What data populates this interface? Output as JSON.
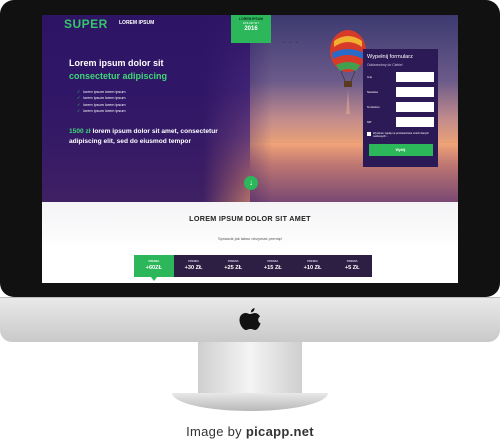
{
  "header": {
    "logo": "SUPER",
    "nav_link": "LOREM IPSUM",
    "badge": {
      "line1": "LOREM IPSUM",
      "line2": "DOLOR SIT",
      "year": "2016"
    }
  },
  "hero": {
    "headline": "Lorem ipsum dolor sit",
    "headline_accent": "consectetur adipiscing",
    "checklist": [
      "lorem ipsum lorem ipsum",
      "lorem ipsum lorem ipsum",
      "lorem ipsum lorem ipsum",
      "lorem ipsum lorem ipsum"
    ],
    "offer_price": "1500 zł",
    "offer_text": "lorem ipsum dolor sit amet, consectetur adipiscing elit, sed do eiusmod tempor"
  },
  "form": {
    "title": "Wypełnij formularz",
    "subtitle": "Oddzwonimy do Ciebie!",
    "fields": [
      "Imię",
      "Nazwisko",
      "Nr telefonu",
      "NIP"
    ],
    "consent": "Wyrażam zgodę na przetwarzanie moich danych osobowych...",
    "submit": "Wyślij"
  },
  "section": {
    "title": "LOREM IPSUM DOLOR SIT AMET",
    "subtitle": "Sprawdź jak łatwo otrzymać premię!",
    "tiers": [
      {
        "label": "PREMIA",
        "value": "+60ZŁ"
      },
      {
        "label": "PREMIA",
        "value": "+30 ZŁ"
      },
      {
        "label": "PREMIA",
        "value": "+25 ZŁ"
      },
      {
        "label": "PREMIA",
        "value": "+15 ZŁ"
      },
      {
        "label": "PREMIA",
        "value": "+10 ZŁ"
      },
      {
        "label": "PREMIA",
        "value": "+5 ZŁ"
      }
    ]
  },
  "credit": {
    "prefix": "Image by",
    "site": "picapp.net"
  },
  "colors": {
    "accent": "#2bb75a",
    "hero_purple": "#2f1668",
    "form_bg": "#2c1a56",
    "tier_bg": "#2d1f43"
  }
}
